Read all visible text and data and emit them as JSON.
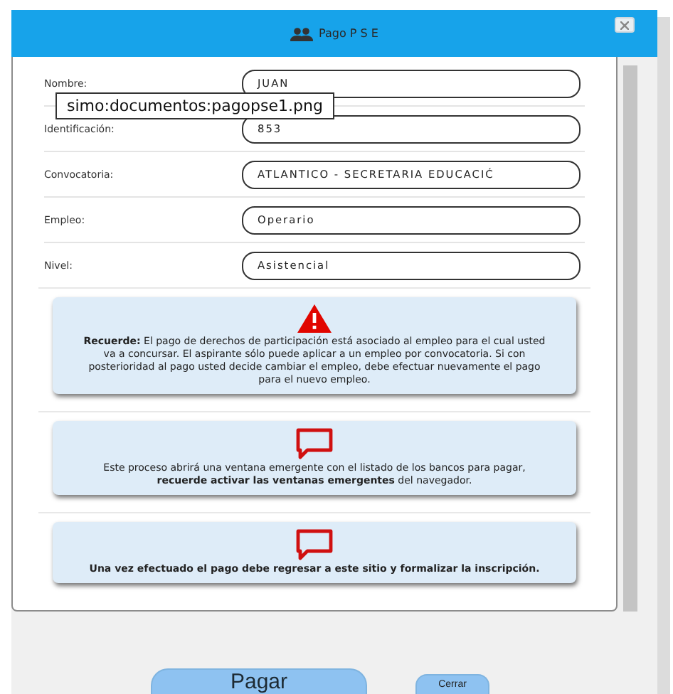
{
  "window": {
    "title": "Pago P S E"
  },
  "tooltip": "simo:documentos:pagopse1.png",
  "fields": [
    {
      "label": "Nombre:",
      "value": "JUAN"
    },
    {
      "label": "Identificación:",
      "value": "853"
    },
    {
      "label": "Convocatoria:",
      "value": "ATLANTICO - SECRETARIA EDUCACIĆ"
    },
    {
      "label": "Empleo:",
      "value": "Operario"
    },
    {
      "label": "Nivel:",
      "value": "Asistencial"
    }
  ],
  "notices": [
    {
      "kind": "warning",
      "text": "**Recuerde:** El pago de derechos de participación está asociado al empleo para el cual usted va a concursar. El aspirante sólo puede aplicar a un empleo por convocatoria. Si con posterioridad al pago usted decide cambiar el empleo, debe efectuar nuevamente el pago para el nuevo empleo."
    },
    {
      "kind": "message",
      "text": "Este proceso abrirá una ventana emergente con el listado de los bancos para pagar, **recuerde activar las ventanas emergentes** del navegador."
    },
    {
      "kind": "message",
      "text": "**Una vez efectuado el pago debe regresar a este sitio y formalizar la inscripción.**"
    }
  ],
  "buttons": [
    {
      "kind": "primary",
      "label": "Pagar"
    },
    {
      "kind": "secondary",
      "label": "Cerrar"
    }
  ]
}
